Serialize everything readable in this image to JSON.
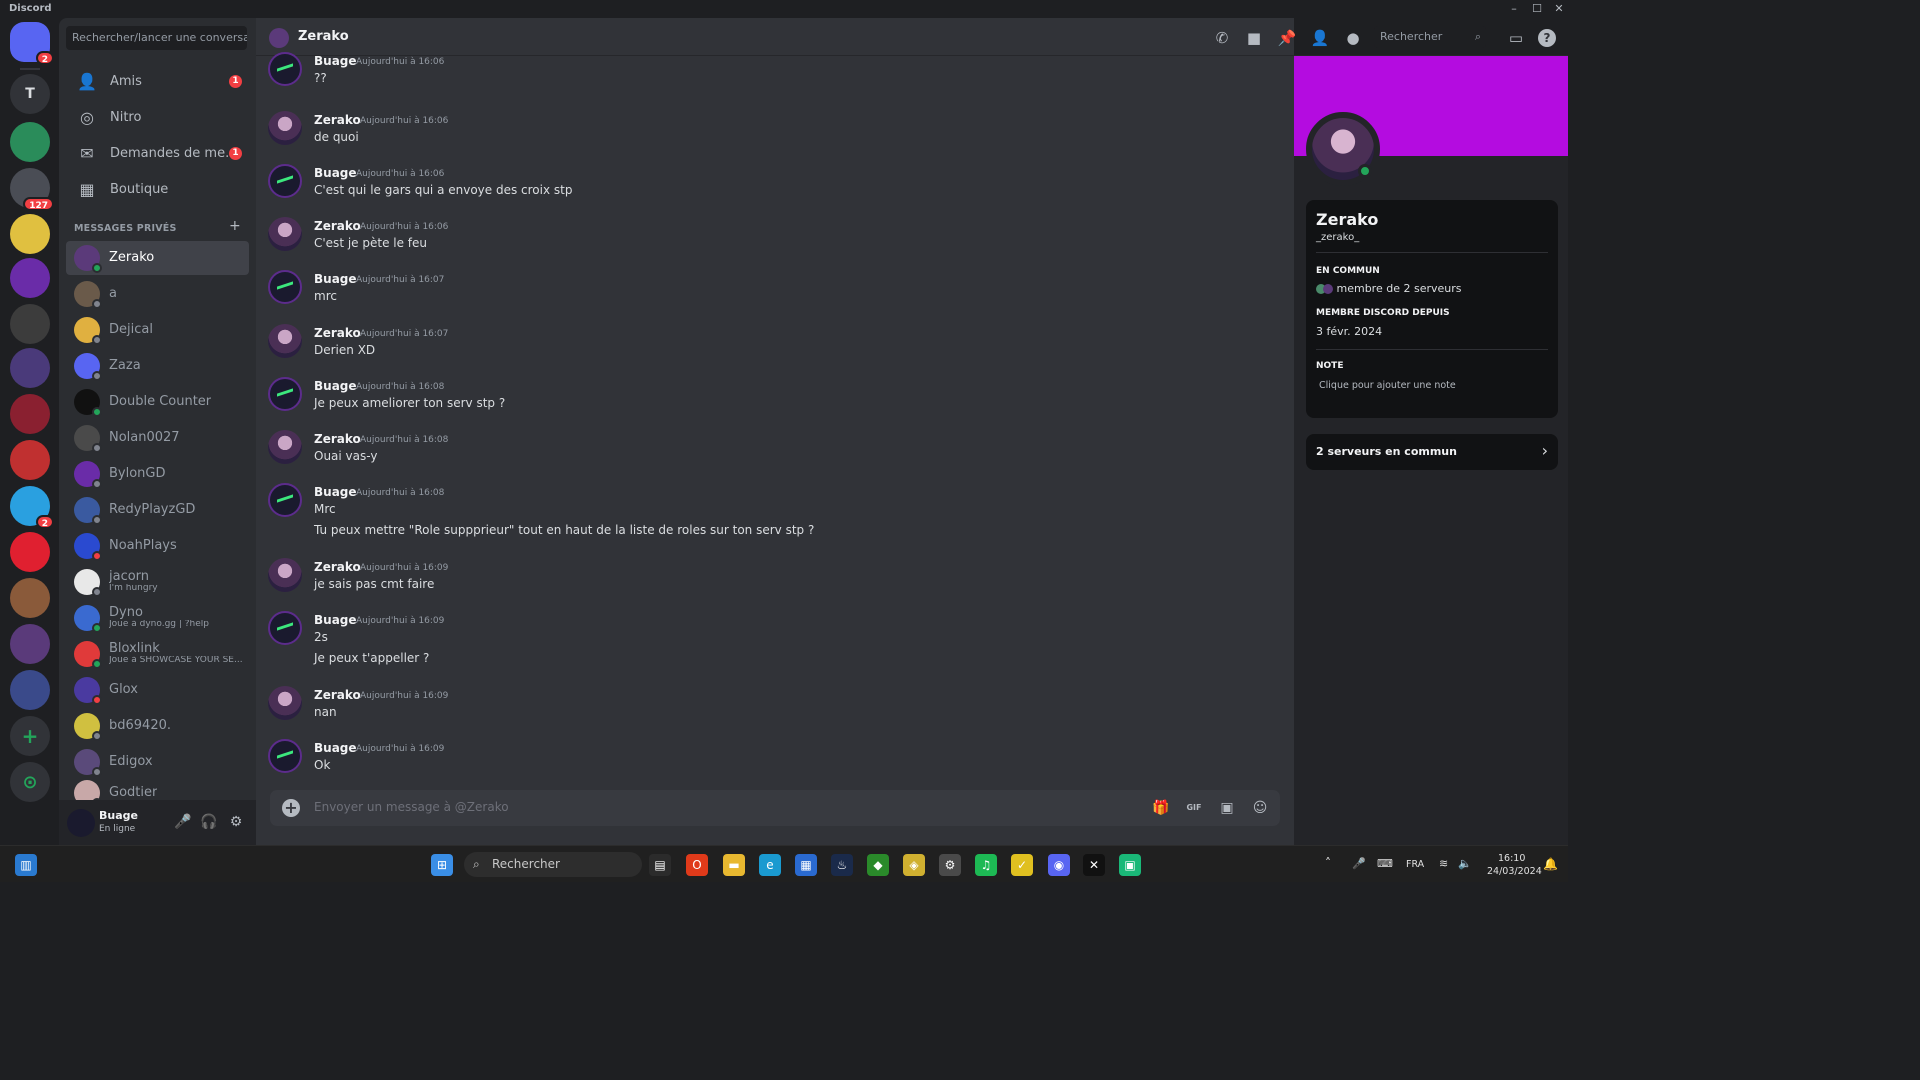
{
  "window": {
    "app_name": "Discord",
    "minimize": "–",
    "maximize": "☐",
    "close": "✕"
  },
  "servers": {
    "items": [
      {
        "label": "",
        "badge": "2",
        "color": "#5865f2"
      },
      {
        "label": "T",
        "badge": "",
        "color": "#313338"
      },
      {
        "label": "",
        "badge": "",
        "color": "#2a8c5a"
      },
      {
        "label": "",
        "badge": "127",
        "color": "#4a4d55"
      },
      {
        "label": "",
        "badge": "",
        "color": "#e0c040"
      },
      {
        "label": "",
        "badge": "",
        "color": "#6a2ca8"
      },
      {
        "label": "",
        "badge": "",
        "color": "#3c3c3c"
      },
      {
        "label": "",
        "badge": "",
        "color": "#4a3a7a"
      },
      {
        "label": "",
        "badge": "",
        "color": "#8a2030"
      },
      {
        "label": "",
        "badge": "",
        "color": "#c03030"
      },
      {
        "label": "",
        "badge": "2",
        "color": "#2aa0e0"
      },
      {
        "label": "",
        "badge": "",
        "color": "#e02030"
      },
      {
        "label": "",
        "badge": "",
        "color": "#8a5a3a"
      },
      {
        "label": "",
        "badge": "",
        "color": "#5a3a7a"
      },
      {
        "label": "",
        "badge": "",
        "color": "#3a4a8a"
      }
    ],
    "add_label": "+",
    "explore_label": "⊙"
  },
  "dm_panel": {
    "search_placeholder": "Rechercher/lancer une conversa...",
    "nav": [
      {
        "label": "Amis",
        "icon": "friends-icon",
        "glyph": "👤",
        "badge": "1"
      },
      {
        "label": "Nitro",
        "icon": "nitro-icon",
        "glyph": "◎",
        "badge": ""
      },
      {
        "label": "Demandes de me...",
        "icon": "mail-icon",
        "glyph": "✉",
        "badge": "1"
      },
      {
        "label": "Boutique",
        "icon": "shop-icon",
        "glyph": "▦",
        "badge": ""
      }
    ],
    "section_title": "MESSAGES PRIVÉS",
    "section_add": "+",
    "dms": [
      {
        "name": "Zerako",
        "sub": "",
        "status": "on",
        "color": "#5b3a7a",
        "active": true
      },
      {
        "name": "a",
        "sub": "",
        "status": "off",
        "color": "#6a5a4a",
        "active": false
      },
      {
        "name": "Dejical",
        "sub": "",
        "status": "off",
        "color": "#e0b040",
        "active": false
      },
      {
        "name": "Zaza",
        "sub": "",
        "status": "off",
        "color": "#5865f2",
        "active": false
      },
      {
        "name": "Double Counter",
        "sub": "",
        "status": "on",
        "color": "#111111",
        "active": false
      },
      {
        "name": "Nolan0027",
        "sub": "",
        "status": "off",
        "color": "#4a4a4a",
        "active": false
      },
      {
        "name": "BylonGD",
        "sub": "",
        "status": "off",
        "color": "#6a2ca8",
        "active": false
      },
      {
        "name": "RedyPlayzGD",
        "sub": "",
        "status": "off",
        "color": "#3a5aa0",
        "active": false
      },
      {
        "name": "NoahPlays",
        "sub": "",
        "status": "dnd",
        "color": "#2a4ad0",
        "active": false
      },
      {
        "name": "jacorn",
        "sub": "I'm hungry",
        "status": "off",
        "color": "#e8e8e8",
        "active": false
      },
      {
        "name": "Dyno",
        "sub": "Joue à dyno.gg | ?help",
        "status": "on",
        "color": "#3a6ad0",
        "active": false
      },
      {
        "name": "Bloxlink",
        "sub": "Joue à SHOWCASE YOUR SE...",
        "status": "on",
        "color": "#e03a3a",
        "active": false
      },
      {
        "name": "Glox",
        "sub": "",
        "status": "dnd",
        "color": "#4a3aa0",
        "active": false
      },
      {
        "name": "bd69420.",
        "sub": "",
        "status": "off",
        "color": "#d0c040",
        "active": false
      },
      {
        "name": "Edigox",
        "sub": "",
        "status": "off",
        "color": "#5a4a7a",
        "active": false
      },
      {
        "name": "Godtier",
        "sub": "",
        "status": "off",
        "color": "#c8a8a8",
        "active": false
      }
    ]
  },
  "user_bar": {
    "name": "Buage",
    "status": "En ligne",
    "mic": "🎤",
    "headset": "🎧",
    "settings": "⚙"
  },
  "chat": {
    "title": "Zerako",
    "search_placeholder": "Rechercher",
    "header_icons": [
      {
        "name": "call-icon",
        "glyph": "✆"
      },
      {
        "name": "video-icon",
        "glyph": "■"
      },
      {
        "name": "pin-icon",
        "glyph": "📌"
      },
      {
        "name": "add-friend-icon",
        "glyph": "👤"
      },
      {
        "name": "profile-icon",
        "glyph": "●"
      }
    ],
    "inbox_glyph": "▭",
    "help_glyph": "?",
    "messages": [
      {
        "author": "Buage",
        "time": "Aujourd'hui à 16:06",
        "lines": [
          "??"
        ]
      },
      {
        "author": "Zerako",
        "time": "Aujourd'hui à 16:06",
        "lines": [
          "de quoi"
        ]
      },
      {
        "author": "Buage",
        "time": "Aujourd'hui à 16:06",
        "lines": [
          "C'est qui le gars qui a envoye des croix stp"
        ]
      },
      {
        "author": "Zerako",
        "time": "Aujourd'hui à 16:06",
        "lines": [
          "C'est je pète le feu"
        ]
      },
      {
        "author": "Buage",
        "time": "Aujourd'hui à 16:07",
        "lines": [
          "mrc"
        ]
      },
      {
        "author": "Zerako",
        "time": "Aujourd'hui à 16:07",
        "lines": [
          "Derien XD"
        ]
      },
      {
        "author": "Buage",
        "time": "Aujourd'hui à 16:08",
        "lines": [
          "Je peux ameliorer ton serv stp ?"
        ]
      },
      {
        "author": "Zerako",
        "time": "Aujourd'hui à 16:08",
        "lines": [
          "Ouai vas-y"
        ]
      },
      {
        "author": "Buage",
        "time": "Aujourd'hui à 16:08",
        "lines": [
          "Mrc",
          "Tu peux mettre \"Role suppprieur\" tout en haut de la liste de roles sur ton serv stp ?"
        ]
      },
      {
        "author": "Zerako",
        "time": "Aujourd'hui à 16:09",
        "lines": [
          "je sais pas cmt faire"
        ]
      },
      {
        "author": "Buage",
        "time": "Aujourd'hui à 16:09",
        "lines": [
          "2s",
          "Je peux t'appeller ?"
        ]
      },
      {
        "author": "Zerako",
        "time": "Aujourd'hui à 16:09",
        "lines": [
          "nan"
        ]
      },
      {
        "author": "Buage",
        "time": "Aujourd'hui à 16:09",
        "lines": [
          "Ok"
        ]
      }
    ],
    "composer": {
      "placeholder": "Envoyer un message à @Zerako",
      "plus": "+",
      "icons": [
        {
          "name": "gift-icon",
          "glyph": "🎁"
        },
        {
          "name": "gif-icon",
          "glyph": "GIF"
        },
        {
          "name": "sticker-icon",
          "glyph": "▣"
        },
        {
          "name": "emoji-icon",
          "glyph": "☺"
        }
      ]
    }
  },
  "profile": {
    "banner_color": "#b40ce0",
    "display_name": "Zerako",
    "username": "_zerako_",
    "common_title": "EN COMMUN",
    "common_value": "membre de 2 serveurs",
    "member_since_title": "MEMBRE DISCORD DEPUIS",
    "member_since": "3 févr. 2024",
    "note_title": "NOTE",
    "note_placeholder": "Clique pour ajouter une note",
    "servers_common": "2 serveurs en commun",
    "chevron": "›"
  },
  "taskbar": {
    "search_placeholder": "Rechercher",
    "apps": [
      {
        "name": "windows-start-icon",
        "glyph": "⊞",
        "color": "#3a8ee6"
      },
      {
        "name": "task-view-icon",
        "glyph": "▤",
        "color": "#2b2b2b"
      },
      {
        "name": "office-icon",
        "glyph": "O",
        "color": "#e03a1a"
      },
      {
        "name": "file-explorer-icon",
        "glyph": "▬",
        "color": "#e8b830"
      },
      {
        "name": "edge-icon",
        "glyph": "e",
        "color": "#1a9ad0"
      },
      {
        "name": "store-icon",
        "glyph": "▦",
        "color": "#2a6ad0"
      },
      {
        "name": "steam-icon",
        "glyph": "♨",
        "color": "#1a2a4a"
      },
      {
        "name": "nvidia-icon",
        "glyph": "◆",
        "color": "#2a8a2a"
      },
      {
        "name": "app-icon",
        "glyph": "◈",
        "color": "#d0b030"
      },
      {
        "name": "settings-icon",
        "glyph": "⚙",
        "color": "#4a4a4a"
      },
      {
        "name": "spotify-icon",
        "glyph": "♫",
        "color": "#1db954"
      },
      {
        "name": "app2-icon",
        "glyph": "✓",
        "color": "#e0c020"
      },
      {
        "name": "discord-icon",
        "glyph": "◉",
        "color": "#5865f2"
      },
      {
        "name": "capcut-icon",
        "glyph": "✕",
        "color": "#111111"
      },
      {
        "name": "app3-icon",
        "glyph": "▣",
        "color": "#1ab878"
      }
    ],
    "tray_chevron": "˄",
    "language": "FRA",
    "time": "16:10",
    "date": "24/03/2024"
  }
}
